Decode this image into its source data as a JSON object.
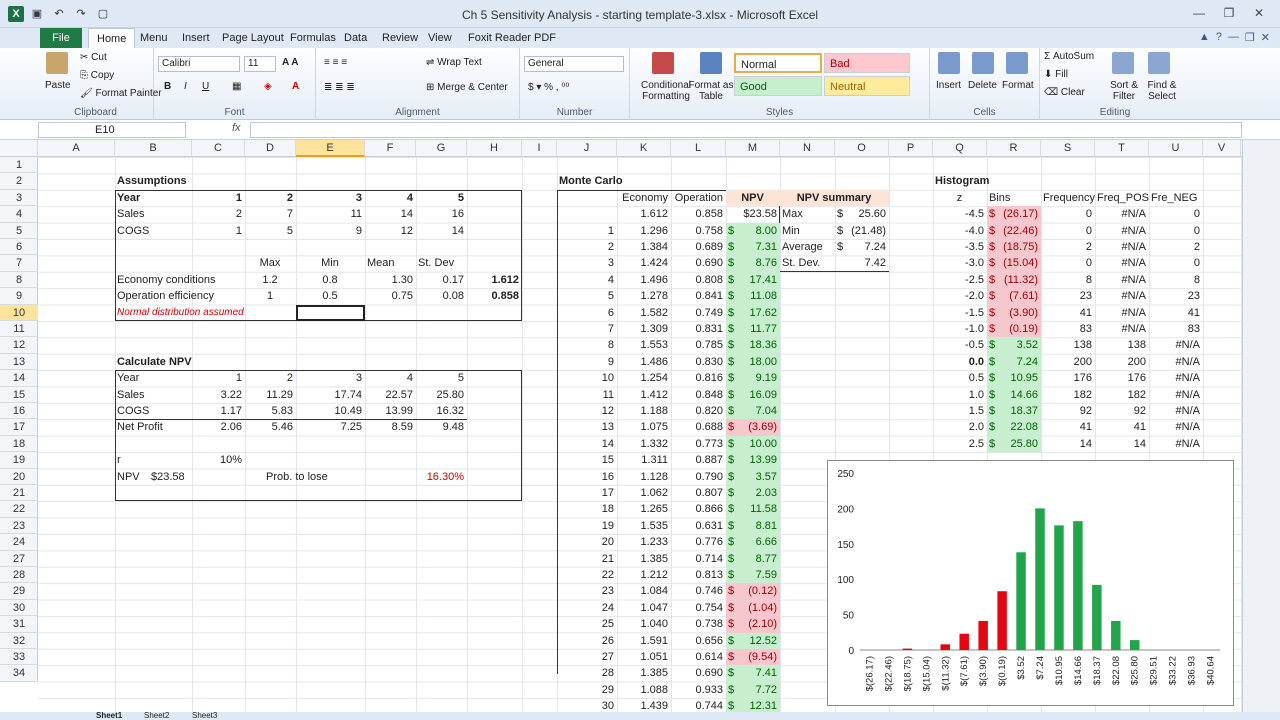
{
  "window": {
    "title": "Ch 5 Sensitivity Analysis - starting template-3.xlsx - Microsoft Excel",
    "app_icon": "X"
  },
  "tabs": [
    "File",
    "Home",
    "Menu",
    "Insert",
    "Page Layout",
    "Formulas",
    "Data",
    "Review",
    "View",
    "Foxit Reader PDF"
  ],
  "active_tab": "Home",
  "ribbon": {
    "clipboard": {
      "paste": "Paste",
      "cut": "Cut",
      "copy": "Copy",
      "format_painter": "Format Painter",
      "label": "Clipboard"
    },
    "font": {
      "name": "Calibri",
      "size": "11",
      "label": "Font"
    },
    "alignment": {
      "wrap": "Wrap Text",
      "merge": "Merge & Center",
      "label": "Alignment"
    },
    "number": {
      "format": "General",
      "label": "Number"
    },
    "styles": {
      "cond": "Conditional Formatting",
      "table": "Format as Table",
      "normal": "Normal",
      "bad": "Bad",
      "good": "Good",
      "neutral": "Neutral",
      "label": "Styles"
    },
    "cells": {
      "insert": "Insert",
      "delete": "Delete",
      "format": "Format",
      "label": "Cells"
    },
    "editing": {
      "autosum": "AutoSum",
      "fill": "Fill",
      "clear": "Clear",
      "sort": "Sort & Filter",
      "find": "Find & Select",
      "label": "Editing"
    }
  },
  "name_box": "E10",
  "fx": "fx",
  "columns": [
    "A",
    "B",
    "C",
    "D",
    "E",
    "F",
    "G",
    "H",
    "I",
    "J",
    "K",
    "L",
    "M",
    "N",
    "O",
    "P",
    "Q",
    "R",
    "S",
    "T",
    "U",
    "V"
  ],
  "selected_column": "E",
  "rows": [
    "1",
    "2",
    "3",
    "4",
    "5",
    "6",
    "7",
    "8",
    "9",
    "10",
    "11",
    "12",
    "13",
    "14",
    "15",
    "16",
    "17",
    "18",
    "19",
    "20",
    "21",
    "22",
    "23",
    "24",
    "27",
    "28",
    "29",
    "30",
    "31",
    "32",
    "33",
    "34"
  ],
  "selected_row": "10",
  "assumptions": {
    "title": "Assumptions",
    "year_label": "Year",
    "years": [
      "1",
      "2",
      "3",
      "4",
      "5"
    ],
    "sales_label": "Sales",
    "sales": [
      "2",
      "7",
      "11",
      "14",
      "16"
    ],
    "cogs_label": "COGS",
    "cogs": [
      "1",
      "5",
      "9",
      "12",
      "14"
    ],
    "max": "Max",
    "min": "Min",
    "mean": "Mean",
    "stdev": "St. Dev",
    "econ_label": "Economy conditions",
    "econ": [
      "1.2",
      "0.8",
      "1.30",
      "0.17",
      "1.612"
    ],
    "op_label": "Operation efficiency",
    "op": [
      "1",
      "0.5",
      "0.75",
      "0.08",
      "0.858"
    ],
    "note": "Normal distribution assumed"
  },
  "npv_calc": {
    "title": "Calculate NPV",
    "year_label": "Year",
    "years": [
      "1",
      "2",
      "3",
      "4",
      "5"
    ],
    "sales_label": "Sales",
    "sales": [
      "3.22",
      "11.29",
      "17.74",
      "22.57",
      "25.80"
    ],
    "cogs_label": "COGS",
    "cogs": [
      "1.17",
      "5.83",
      "10.49",
      "13.99",
      "16.32"
    ],
    "np_label": "Net Profit",
    "np": [
      "2.06",
      "5.46",
      "7.25",
      "8.59",
      "9.48"
    ],
    "r_label": "r",
    "r": "10%",
    "npv_label": "NPV",
    "npv": "$23.58",
    "prob_label": "Prob. to lose",
    "prob": "16.30%"
  },
  "monte_carlo": {
    "title": "Monte Carlo",
    "headers": [
      "Economy",
      "Operation",
      "NPV"
    ],
    "first": [
      "1.612",
      "0.858",
      "$23.58"
    ],
    "rows": [
      [
        "1",
        "1.296",
        "0.758",
        "8.00"
      ],
      [
        "2",
        "1.384",
        "0.689",
        "7.31"
      ],
      [
        "3",
        "1.424",
        "0.690",
        "8.76"
      ],
      [
        "4",
        "1.496",
        "0.808",
        "17.41"
      ],
      [
        "5",
        "1.278",
        "0.841",
        "11.08"
      ],
      [
        "6",
        "1.582",
        "0.749",
        "17.62"
      ],
      [
        "7",
        "1.309",
        "0.831",
        "11.77"
      ],
      [
        "8",
        "1.553",
        "0.785",
        "18.36"
      ],
      [
        "9",
        "1.486",
        "0.830",
        "18.00"
      ],
      [
        "10",
        "1.254",
        "0.816",
        "9.19"
      ],
      [
        "11",
        "1.412",
        "0.848",
        "16.09"
      ],
      [
        "12",
        "1.188",
        "0.820",
        "7.04"
      ],
      [
        "13",
        "1.075",
        "0.688",
        "(3.69)"
      ],
      [
        "14",
        "1.332",
        "0.773",
        "10.00"
      ],
      [
        "15",
        "1.311",
        "0.887",
        "13.99"
      ],
      [
        "16",
        "1.128",
        "0.790",
        "3.57"
      ],
      [
        "17",
        "1.062",
        "0.807",
        "2.03"
      ],
      [
        "18",
        "1.265",
        "0.866",
        "11.58"
      ],
      [
        "19",
        "1.535",
        "0.631",
        "8.81"
      ],
      [
        "20",
        "1.233",
        "0.776",
        "6.66"
      ],
      [
        "21",
        "1.385",
        "0.714",
        "8.77"
      ],
      [
        "22",
        "1.212",
        "0.813",
        "7.59"
      ],
      [
        "23",
        "1.084",
        "0.746",
        "(0.12)"
      ],
      [
        "24",
        "1.047",
        "0.754",
        "(1.04)"
      ],
      [
        "25",
        "1.040",
        "0.738",
        "(2.10)"
      ],
      [
        "26",
        "1.591",
        "0.656",
        "12.52"
      ],
      [
        "27",
        "1.051",
        "0.614",
        "(9.54)"
      ],
      [
        "28",
        "1.385",
        "0.690",
        "7.41"
      ],
      [
        "29",
        "1.088",
        "0.933",
        "7.72"
      ],
      [
        "30",
        "1.439",
        "0.744",
        "12.31"
      ]
    ],
    "summary_title": "NPV summary",
    "summary": [
      [
        "Max",
        "$",
        "25.60"
      ],
      [
        "Min",
        "$",
        "(21.48)"
      ],
      [
        "Average",
        "$",
        "7.24"
      ],
      [
        "St. Dev.",
        "",
        "7.42"
      ]
    ]
  },
  "histogram": {
    "title": "Histogram",
    "headers": [
      "z",
      "Bins",
      "Frequency",
      "Freq_POS",
      "Fre_NEG"
    ],
    "rows": [
      [
        "-4.5",
        "(26.17)",
        "0",
        "#N/A",
        "0"
      ],
      [
        "-4.0",
        "(22.46)",
        "0",
        "#N/A",
        "0"
      ],
      [
        "-3.5",
        "(18.75)",
        "2",
        "#N/A",
        "2"
      ],
      [
        "-3.0",
        "(15.04)",
        "0",
        "#N/A",
        "0"
      ],
      [
        "-2.5",
        "(11.32)",
        "8",
        "#N/A",
        "8"
      ],
      [
        "-2.0",
        "(7.61)",
        "23",
        "#N/A",
        "23"
      ],
      [
        "-1.5",
        "(3.90)",
        "41",
        "#N/A",
        "41"
      ],
      [
        "-1.0",
        "(0.19)",
        "83",
        "#N/A",
        "83"
      ],
      [
        "-0.5",
        "3.52",
        "138",
        "138",
        "#N/A"
      ],
      [
        "0.0",
        "7.24",
        "200",
        "200",
        "#N/A"
      ],
      [
        "0.5",
        "10.95",
        "176",
        "176",
        "#N/A"
      ],
      [
        "1.0",
        "14.66",
        "182",
        "182",
        "#N/A"
      ],
      [
        "1.5",
        "18.37",
        "92",
        "92",
        "#N/A"
      ],
      [
        "2.0",
        "22.08",
        "41",
        "41",
        "#N/A"
      ],
      [
        "2.5",
        "25.80",
        "14",
        "14",
        "#N/A"
      ]
    ]
  },
  "chart_data": {
    "type": "bar",
    "categories": [
      "$(26.17)",
      "$(22.46)",
      "$(18.75)",
      "$(15.04)",
      "$(11.32)",
      "$(7.61)",
      "$(3.90)",
      "$(0.19)",
      "$3.52",
      "$7.24",
      "$10.95",
      "$14.66",
      "$18.37",
      "$22.08",
      "$25.80",
      "$29.51",
      "$33.22",
      "$36.93",
      "$40.64"
    ],
    "series": [
      {
        "values": [
          0,
          0,
          2,
          0,
          8,
          23,
          41,
          83,
          0,
          0,
          0,
          0,
          0,
          0,
          0,
          0,
          0,
          0,
          0
        ],
        "color": "#e30613"
      },
      {
        "values": [
          0,
          0,
          0,
          0,
          0,
          0,
          0,
          0,
          138,
          200,
          176,
          182,
          92,
          41,
          14,
          0,
          0,
          0,
          0
        ],
        "color": "#22a44a"
      }
    ],
    "yticks": [
      "0",
      "50",
      "100",
      "150",
      "200",
      "250"
    ],
    "ylim": [
      0,
      250
    ],
    "grid": false
  },
  "sheets": [
    "Sheet1",
    "Sheet2",
    "Sheet3"
  ]
}
